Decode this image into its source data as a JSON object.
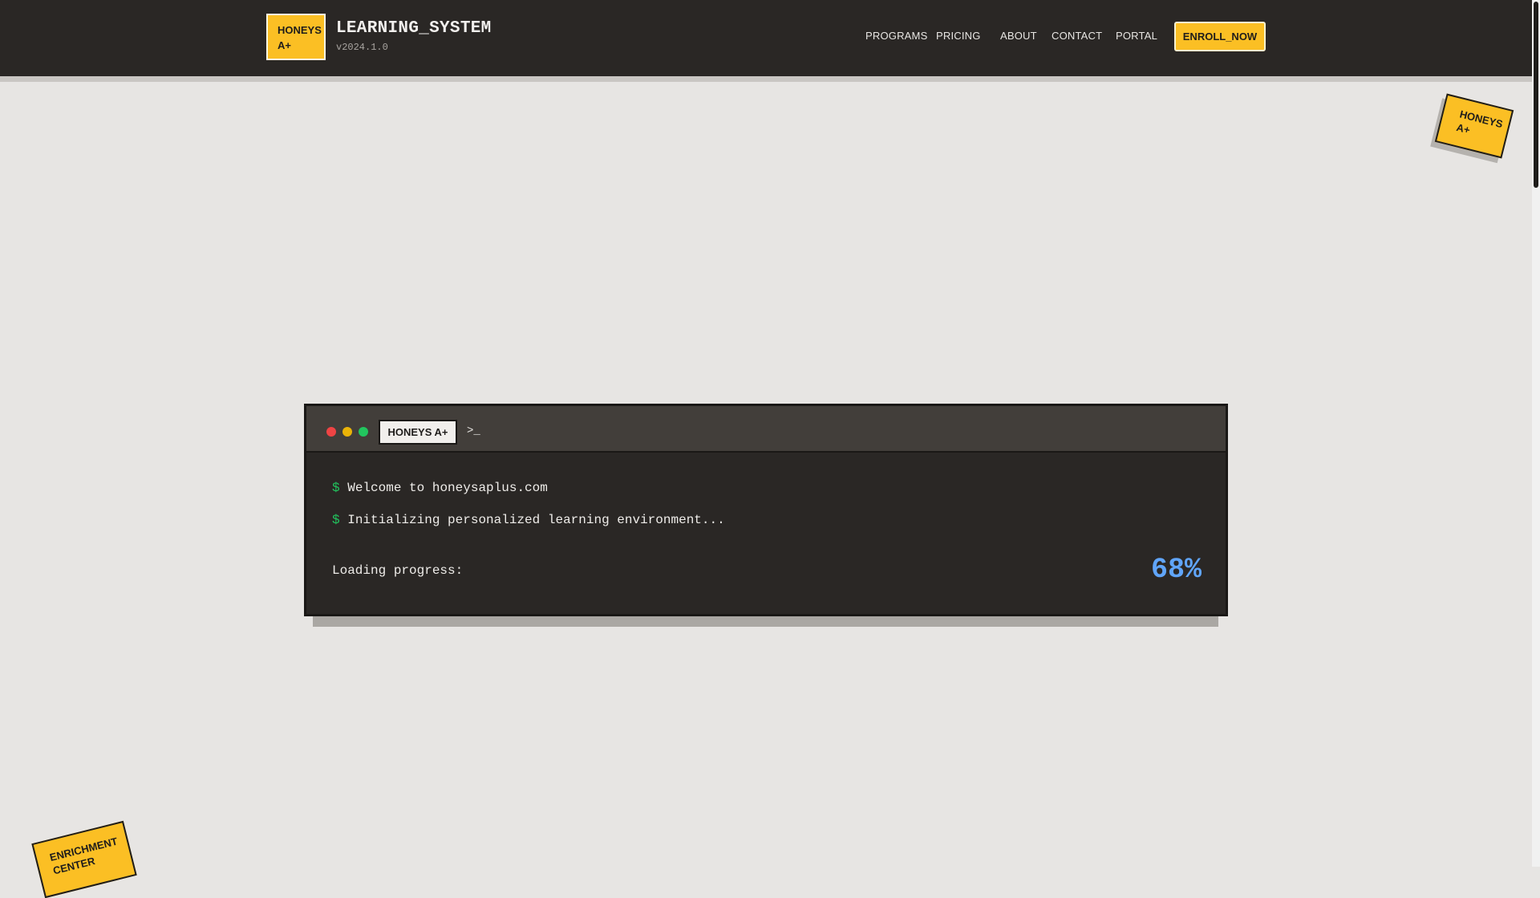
{
  "header": {
    "logo_line1": "HONEYS",
    "logo_line2": "A+",
    "title": "LEARNING_SYSTEM",
    "version": "v2024.1.0",
    "nav": [
      "PROGRAMS",
      "PRICING",
      "ABOUT",
      "CONTACT",
      "PORTAL"
    ],
    "cta_label": "ENROLL_NOW"
  },
  "stickers": {
    "top_line1": "HONEYS",
    "top_line2": "A+",
    "bottom_line1": "ENRICHMENT",
    "bottom_line2": "CENTER"
  },
  "terminal": {
    "tab_label": "HONEYS A+",
    "prompt_icon": ">_",
    "prompt_symbol": "$",
    "lines": [
      "Welcome to honeysaplus.com",
      "Initializing personalized learning environment..."
    ],
    "progress_label": "Loading progress:",
    "progress_value": "68%"
  },
  "colors": {
    "accent": "#fbbf24",
    "dark": "#2a2725",
    "progress": "#60a5fa",
    "prompt": "#22c55e"
  },
  "icons": {
    "window_controls": [
      "close-dot-icon",
      "minimize-dot-icon",
      "maximize-dot-icon"
    ],
    "prompt": "terminal-prompt-icon"
  }
}
